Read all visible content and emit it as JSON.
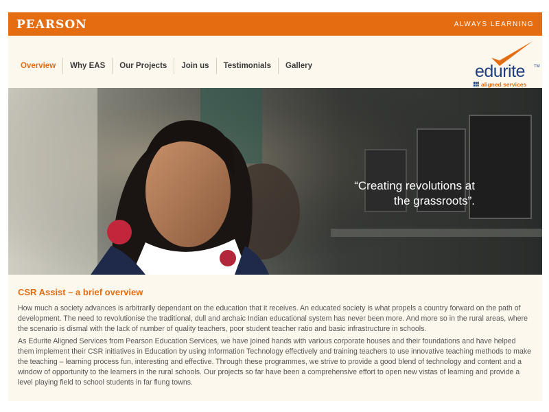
{
  "header": {
    "brand": "PEARSON",
    "tagline": "ALWAYS LEARNING"
  },
  "nav": {
    "items": [
      {
        "label": "Overview",
        "active": true
      },
      {
        "label": "Why EAS",
        "active": false
      },
      {
        "label": "Our Projects",
        "active": false
      },
      {
        "label": "Join us",
        "active": false
      },
      {
        "label": "Testimonials",
        "active": false
      },
      {
        "label": "Gallery",
        "active": false
      }
    ]
  },
  "logo": {
    "word": "edurite",
    "trademark": "TM",
    "subtitle": "aligned services"
  },
  "hero": {
    "quote_line1": "“Creating revolutions at",
    "quote_line2": "the grassroots”."
  },
  "content": {
    "title": "CSR Assist – a brief overview",
    "paragraph1": "How much a society advances is arbitrarily dependant on the education that it receives. An educated society is what propels a country forward on the path of development. The need to revolutionise the traditional, dull and archaic Indian educational system has never been more. And more so in the rural areas, where the scenario is dismal with the lack of number of quality teachers, poor student teacher ratio and basic infrastructure in schools.",
    "paragraph2": "As Edurite Aligned Services from Pearson Education Services, we have joined hands with various corporate houses and their foundations and have helped them implement their CSR initiatives in Education by using Information Technology effectively and training teachers to use innovative teaching methods to make the teaching – learning process fun, interesting and effective. Through these programmes, we strive to provide a good blend of technology and content and a window of opportunity to the learners in the rural schools. Our projects so far have been a comprehensive effort to open new vistas of learning and provide a level playing field to school students in far flung towns."
  },
  "colors": {
    "brand_orange": "#e46d12",
    "logo_blue": "#1e3f7f",
    "page_background": "#fdf8ee",
    "body_text": "#555555"
  }
}
